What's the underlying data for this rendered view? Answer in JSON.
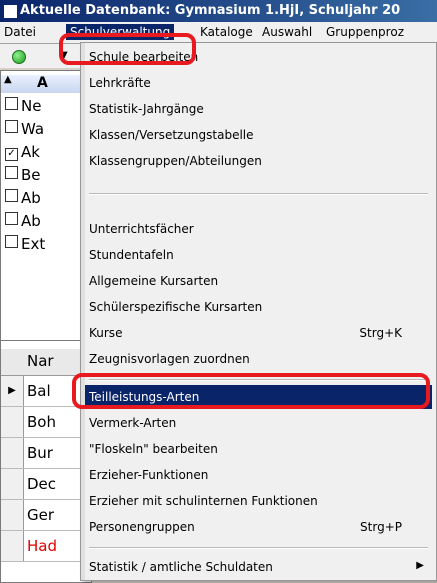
{
  "window": {
    "title": "Aktuelle Datenbank: Gymnasium 1.HjI, Schuljahr 20"
  },
  "menubar": {
    "items": [
      {
        "label": "Datei"
      },
      {
        "label": "Schulverwaltung"
      },
      {
        "label": "Kataloge"
      },
      {
        "label": "Auswahl"
      },
      {
        "label": "Gruppenproz"
      }
    ]
  },
  "toolbar": {
    "status_icon": "green-led-icon",
    "dropdown_icon": "chevron-down-icon"
  },
  "left_panel": {
    "header": "A",
    "rows": [
      {
        "label": "Ne",
        "checked": false
      },
      {
        "label": "Wa",
        "checked": false
      },
      {
        "label": "Ak",
        "checked": true
      },
      {
        "label": "Be",
        "checked": false
      },
      {
        "label": "Ab",
        "checked": false
      },
      {
        "label": "Ab",
        "checked": false
      },
      {
        "label": "Ext",
        "checked": false
      }
    ]
  },
  "grid": {
    "column_header": "Nar",
    "rows": [
      {
        "name": "Bal",
        "current": true,
        "color": "#000000"
      },
      {
        "name": "Boh",
        "current": false,
        "color": "#000000"
      },
      {
        "name": "Bur",
        "current": false,
        "color": "#000000"
      },
      {
        "name": "Dec",
        "current": false,
        "color": "#000000"
      },
      {
        "name": "Ger",
        "current": false,
        "color": "#000000"
      },
      {
        "name": "Had",
        "current": false,
        "color": "#e00000"
      }
    ]
  },
  "dropdown": {
    "items": [
      {
        "label": "Schule bearbeiten",
        "shortcut": ""
      },
      {
        "label": "Lehrkräfte",
        "shortcut": ""
      },
      {
        "label": "Statistik-Jahrgänge",
        "shortcut": ""
      },
      {
        "label": "Klassen/Versetzungstabelle",
        "shortcut": ""
      },
      {
        "label": "Klassengruppen/Abteilungen",
        "shortcut": ""
      },
      {
        "label": "Unterrichtsfächer",
        "shortcut": ""
      },
      {
        "label": "Stundentafeln",
        "shortcut": ""
      },
      {
        "label": "Allgemeine Kursarten",
        "shortcut": ""
      },
      {
        "label": "Schülerspezifische Kursarten",
        "shortcut": ""
      },
      {
        "label": "Kurse",
        "shortcut": "Strg+K"
      },
      {
        "label": "Zeugnisvorlagen zuordnen",
        "shortcut": ""
      },
      {
        "label": "Teilleistungs-Arten",
        "shortcut": "",
        "highlighted": true
      },
      {
        "label": "Vermerk-Arten",
        "shortcut": ""
      },
      {
        "label": "\"Floskeln\" bearbeiten",
        "shortcut": ""
      },
      {
        "label": "Erzieher-Funktionen",
        "shortcut": ""
      },
      {
        "label": "Erzieher mit schulinternen Funktionen",
        "shortcut": ""
      },
      {
        "label": "Personengruppen",
        "shortcut": "Strg+P"
      },
      {
        "label": "Statistik / amtliche Schuldaten",
        "shortcut": "",
        "submenu": true
      }
    ]
  },
  "annotations": {
    "highlight_color": "#e8191f"
  }
}
